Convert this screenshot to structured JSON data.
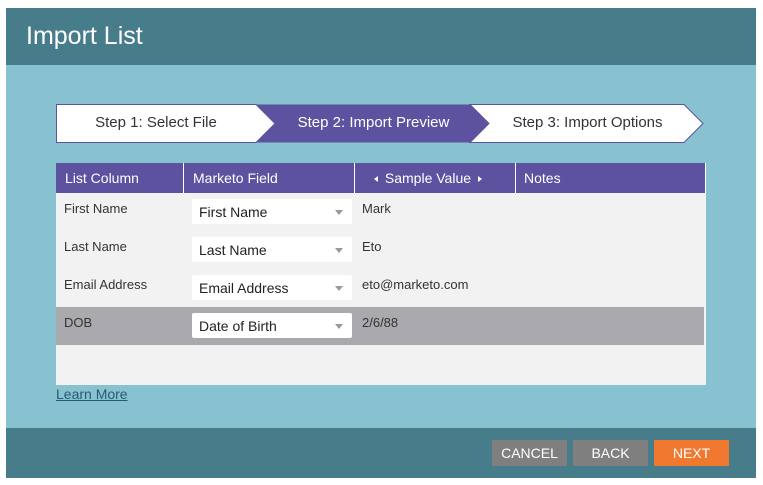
{
  "dialog": {
    "title": "Import List"
  },
  "wizard": {
    "steps": [
      {
        "label": "Step 1: Select File",
        "active": false
      },
      {
        "label": "Step 2: Import Preview",
        "active": true
      },
      {
        "label": "Step 3: Import Options",
        "active": false
      }
    ]
  },
  "table": {
    "headers": {
      "list_column": "List Column",
      "marketo_field": "Marketo Field",
      "sample_value": "Sample Value",
      "notes": "Notes"
    },
    "rows": [
      {
        "list_column": "First Name",
        "marketo_field": "First Name",
        "sample_value": "Mark",
        "notes": "",
        "selected": false
      },
      {
        "list_column": "Last Name",
        "marketo_field": "Last Name",
        "sample_value": "Eto",
        "notes": "",
        "selected": false
      },
      {
        "list_column": "Email Address",
        "marketo_field": "Email Address",
        "sample_value": "eto@marketo.com",
        "notes": "",
        "selected": false
      },
      {
        "list_column": "DOB",
        "marketo_field": "Date of Birth",
        "sample_value": "2/6/88",
        "notes": "",
        "selected": true
      }
    ]
  },
  "links": {
    "learn_more": "Learn More"
  },
  "footer": {
    "cancel": "CANCEL",
    "back": "BACK",
    "next": "NEXT"
  },
  "colors": {
    "header": "#477c8b",
    "body": "#88c1cf",
    "accent": "#5c52a0",
    "primary_button": "#f0782f",
    "secondary_button": "#7f7f7f"
  }
}
